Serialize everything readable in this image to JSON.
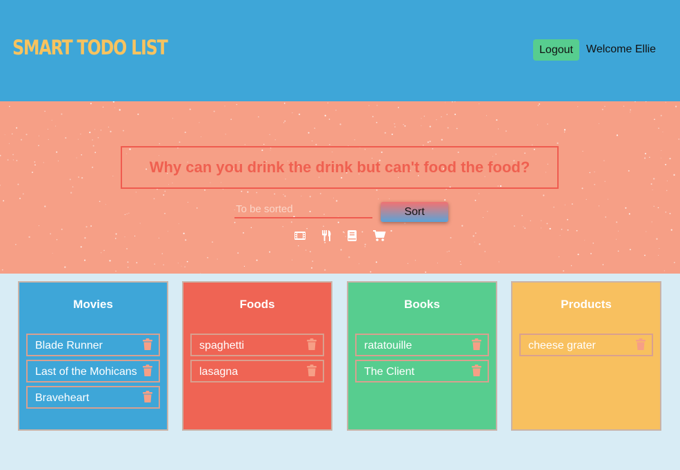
{
  "header": {
    "brand": "SMART TODO LIST",
    "logout_label": "Logout",
    "welcome_text": "Welcome Ellie"
  },
  "hero": {
    "question": "Why can you drink the drink but can't food the food?",
    "input_placeholder": "To be sorted",
    "input_value": "",
    "sort_label": "Sort",
    "category_icons": [
      "film-icon",
      "utensils-icon",
      "book-icon",
      "cart-icon"
    ]
  },
  "categories": [
    {
      "title": "Movies",
      "color": "#3ea6d8",
      "items": [
        "Blade Runner",
        "Last of the Mohicans",
        "Braveheart"
      ]
    },
    {
      "title": "Foods",
      "color": "#ef6454",
      "items": [
        "spaghetti",
        "lasagna"
      ]
    },
    {
      "title": "Books",
      "color": "#57cd8f",
      "items": [
        "ratatouille",
        "The Client"
      ]
    },
    {
      "title": "Products",
      "color": "#f8c05f",
      "items": [
        "cheese grater"
      ]
    }
  ],
  "colors": {
    "header_bg": "#3ea6d8",
    "brand": "#f7c35f",
    "hero_bg": "#f69f86",
    "accent_red": "#ef5b4f",
    "logout_bg": "#57cd8f",
    "trash": "#f69f86",
    "page_bg": "#d8ecf5"
  }
}
